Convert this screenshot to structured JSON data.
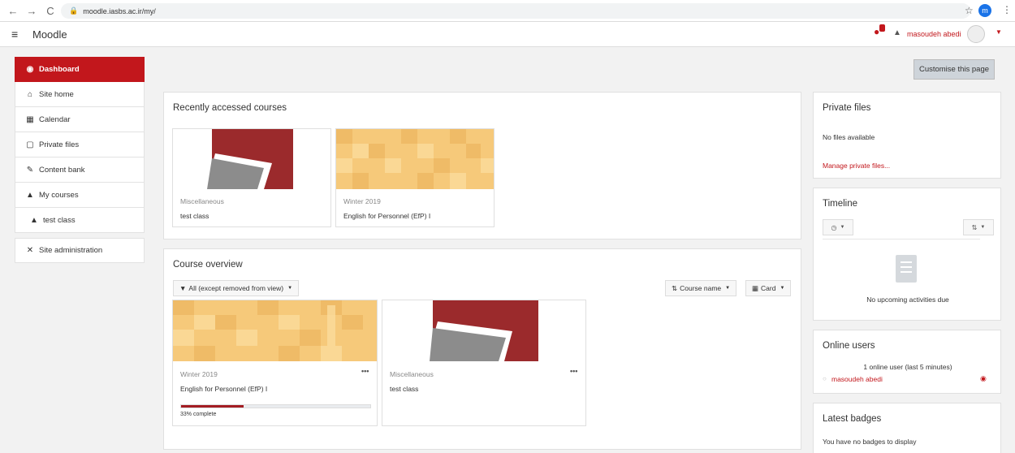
{
  "browser": {
    "url": "moodle.iasbs.ac.ir/my/",
    "back_icon": "←",
    "forward_icon": "→",
    "reload_icon": "C",
    "profile_letter": "m"
  },
  "navbar": {
    "brand": "Moodle",
    "user_name": "masoudeh abedi"
  },
  "sidebar": {
    "items": [
      {
        "label": "Dashboard",
        "icon": "dashboard-icon"
      },
      {
        "label": "Site home",
        "icon": "home-icon"
      },
      {
        "label": "Calendar",
        "icon": "calendar-icon"
      },
      {
        "label": "Private files",
        "icon": "file-icon"
      },
      {
        "label": "Content bank",
        "icon": "brush-icon"
      },
      {
        "label": "My courses",
        "icon": "graduation-cap-icon"
      },
      {
        "label": "test class",
        "icon": "graduation-cap-icon"
      },
      {
        "label": "Site administration",
        "icon": "wrench-icon"
      }
    ]
  },
  "main": {
    "customise_label": "Customise this page",
    "recent": {
      "title": "Recently accessed courses",
      "courses": [
        {
          "category": "Miscellaneous",
          "name": "test class"
        },
        {
          "category": "Winter 2019",
          "name": "English for Personnel (EfP) I"
        }
      ]
    },
    "overview": {
      "title": "Course overview",
      "filter_label": "All (except removed from view)",
      "sort_label": "Course name",
      "view_label": "Card",
      "courses": [
        {
          "category": "Winter 2019",
          "name": "English for Personnel (EfP) I",
          "progress_percent": 33,
          "progress_label": "33% complete"
        },
        {
          "category": "Miscellaneous",
          "name": "test class"
        }
      ]
    }
  },
  "right": {
    "private_files": {
      "title": "Private files",
      "empty": "No files available",
      "link": "Manage private files..."
    },
    "timeline": {
      "title": "Timeline",
      "empty": "No upcoming activities due"
    },
    "online_users": {
      "title": "Online users",
      "summary": "1 online user (last 5 minutes)",
      "user": "masoudeh abedi"
    },
    "badges": {
      "title": "Latest badges",
      "empty": "You have no badges to display"
    }
  },
  "colors": {
    "brand_red": "#c2171c",
    "course_red": "#9b2a2c",
    "course_orange": "#f6c97a"
  }
}
